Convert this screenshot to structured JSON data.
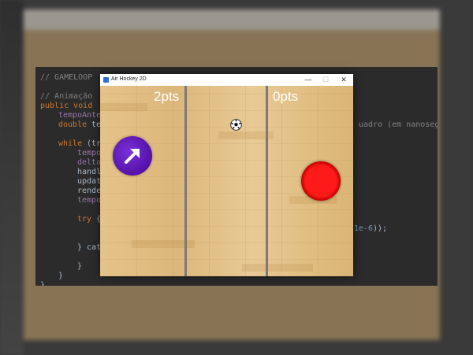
{
  "window": {
    "title": "Air Hockey 2D"
  },
  "scores": {
    "left": "2pts",
    "right": "0pts"
  },
  "colors": {
    "left_paddle": "#5511a8",
    "right_paddle": "#e00000",
    "divider": "#7a7a7a"
  },
  "icons": {
    "left_paddle": "arrow-up-right-icon",
    "puck": "soccer-ball-icon"
  },
  "code": {
    "line1": "// GAMELOOP",
    "line2": "// Animação",
    "line3_kw": "public void",
    "line4": "tempoAnte",
    "line5_kw": "double",
    "line5_rest": " te",
    "line5_tail": "uadro (em nanosegu",
    "line6_kw": "while",
    "line6_rest": " (tr",
    "line7": "tempo",
    "line8": "delta",
    "line9": "handl",
    "line10": "updat",
    "line11": "rende",
    "line12": "tempo",
    "line13_kw": "try",
    "line13_rest": " {",
    "line14_tail_num": "1e-6",
    "line14_tail": "));",
    "line15": "} cat",
    "line17": "}",
    "line18": "}",
    "line19": "}"
  }
}
